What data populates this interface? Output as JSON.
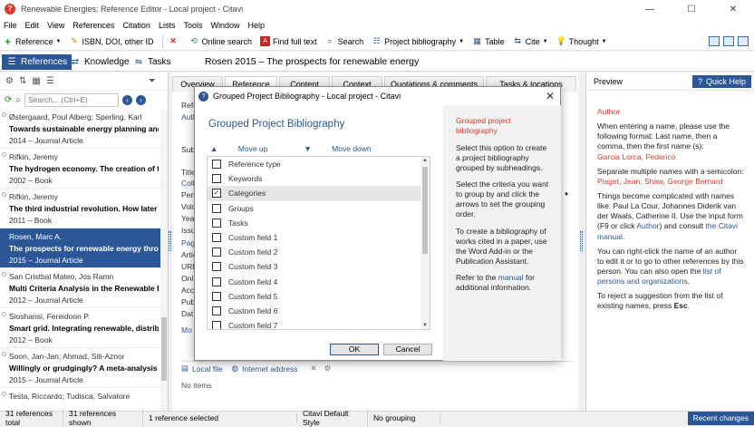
{
  "window": {
    "title": "Renewable Energies: Reference Editor - Local project - Citavi",
    "minimize": "—",
    "maximize": "☐",
    "close": "✕"
  },
  "menu": [
    "File",
    "Edit",
    "View",
    "References",
    "Citation",
    "Lists",
    "Tools",
    "Window",
    "Help"
  ],
  "toolbar": {
    "reference": "Reference",
    "isbn": "ISBN, DOI, other ID",
    "online_search": "Online search",
    "find_full_text": "Find full text",
    "search": "Search",
    "project_bibliography": "Project bibliography",
    "table": "Table",
    "cite": "Cite",
    "thought": "Thought"
  },
  "nav": {
    "references": "References",
    "knowledge": "Knowledge",
    "tasks": "Tasks"
  },
  "doc_title": "Rosen 2015 – The prospects for renewable energy",
  "left": {
    "search_placeholder": "Search... (Ctrl+E)",
    "items": [
      {
        "authors": "Østergaard, Poul Alberg; Sperling, Karl",
        "title": "Towards sustainable energy planning and",
        "type": "2014 – Journal Article"
      },
      {
        "authors": "Rifkin, Jeremy",
        "title": "The hydrogen economy. The creation of t",
        "type": "2002 – Book"
      },
      {
        "authors": "Rifkin, Jeremy",
        "title": "The third industrial revolution. How later",
        "type": "2011 – Book"
      },
      {
        "authors": "Rosen, Marc A.",
        "title": "The prospects for renewable energy thro",
        "type": "2015 – Journal Article"
      },
      {
        "authors": "San Cristbal Mateo, Jos Ramn",
        "title": "Multi Criteria Analysis in the Renewable E",
        "type": "2012 – Journal Article"
      },
      {
        "authors": "Sioshansi, Fereidoon P.",
        "title": "Smart grid. Integrating renewable, distrib",
        "type": "2012 – Book"
      },
      {
        "authors": "Soon, Jan-Jan; Ahmad, Siti-Aznor",
        "title": "Willingly or grudgingly? A meta-analysis o",
        "type": "2015 – Journal Article"
      },
      {
        "authors": "Testa, Riccardo; Tudisca, Salvatore",
        "title": "",
        "type": ""
      }
    ]
  },
  "center": {
    "tabs": [
      "Overview",
      "Reference",
      "Content",
      "Context",
      "Quotations & comments",
      "Tasks & locations"
    ],
    "side_labels": [
      "Refe",
      "Auth",
      "Subt",
      "Title",
      "Coll",
      "Peri",
      "Volu",
      "Yea",
      "Issu",
      "Pag",
      "Artic",
      "URL",
      "Onl",
      "Acc",
      "Pub",
      "Dat",
      "Mo"
    ],
    "local_file": "Local file",
    "internet_address": "Internet address",
    "no_items": "No items"
  },
  "dialog": {
    "title": "Grouped Project Bibliography - Local project - Citavi",
    "heading": "Grouped Project Bibliography",
    "move_up": "Move up",
    "move_down": "Move down",
    "criteria": [
      {
        "label": "Reference type",
        "checked": false
      },
      {
        "label": "Keywords",
        "checked": false
      },
      {
        "label": "Categories",
        "checked": true
      },
      {
        "label": "Groups",
        "checked": false
      },
      {
        "label": "Tasks",
        "checked": false
      },
      {
        "label": "Custom field 1",
        "checked": false
      },
      {
        "label": "Custom field 2",
        "checked": false
      },
      {
        "label": "Custom field 3",
        "checked": false
      },
      {
        "label": "Custom field 4",
        "checked": false
      },
      {
        "label": "Custom field 5",
        "checked": false
      },
      {
        "label": "Custom field 6",
        "checked": false
      },
      {
        "label": "Custom field 7",
        "checked": false
      }
    ],
    "help_title": "Grouped project bibliography",
    "help_p1": "Select this option to create a project bibliography grouped by subheadings.",
    "help_p2": "Select the criteria you want to group by and click the arrows to set the grouping order.",
    "help_p3": "To create a bibliography of works cited in a paper, use the Word Add-in or the Publication Assistant.",
    "help_p4_pre": "Refer to the ",
    "help_p4_link": "manual",
    "help_p4_post": " for additional information.",
    "ok": "OK",
    "cancel": "Cancel"
  },
  "right": {
    "preview": "Preview",
    "quick_help": "Quick Help",
    "field": "Author",
    "p1": "When entering a name, please use the following format:",
    "p2": "Last name, then a comma, then the first name (s):",
    "example1": "Garcia Lorca, Federico",
    "p3": "Separate multiple names with a semicolon:",
    "example2": "Piaget, Jean; Shaw, George Bernard",
    "p4a": "Things become complicated with names like: Paul La Cour, Johannes Diderik van der Waals, Catherine II. Use the input form (F9 or click ",
    "p4link1": "Author",
    "p4b": ") and consult ",
    "p4link2": "the Citavi manual",
    "p4c": ".",
    "p5a": "You can right-click the name of an author to edit it or to go to other references by this person. You can also open the ",
    "p5link": "list of persons and organizations",
    "p5b": ".",
    "p6a": "To reject a suggestion from the list of existing names, press ",
    "p6key": "Esc",
    "p6b": "."
  },
  "status": {
    "total": "31 references total",
    "shown": "31 references shown",
    "selected": "1 reference selected",
    "style": "Citavi Default Style",
    "grouping": "No grouping",
    "recent": "Recent changes"
  }
}
